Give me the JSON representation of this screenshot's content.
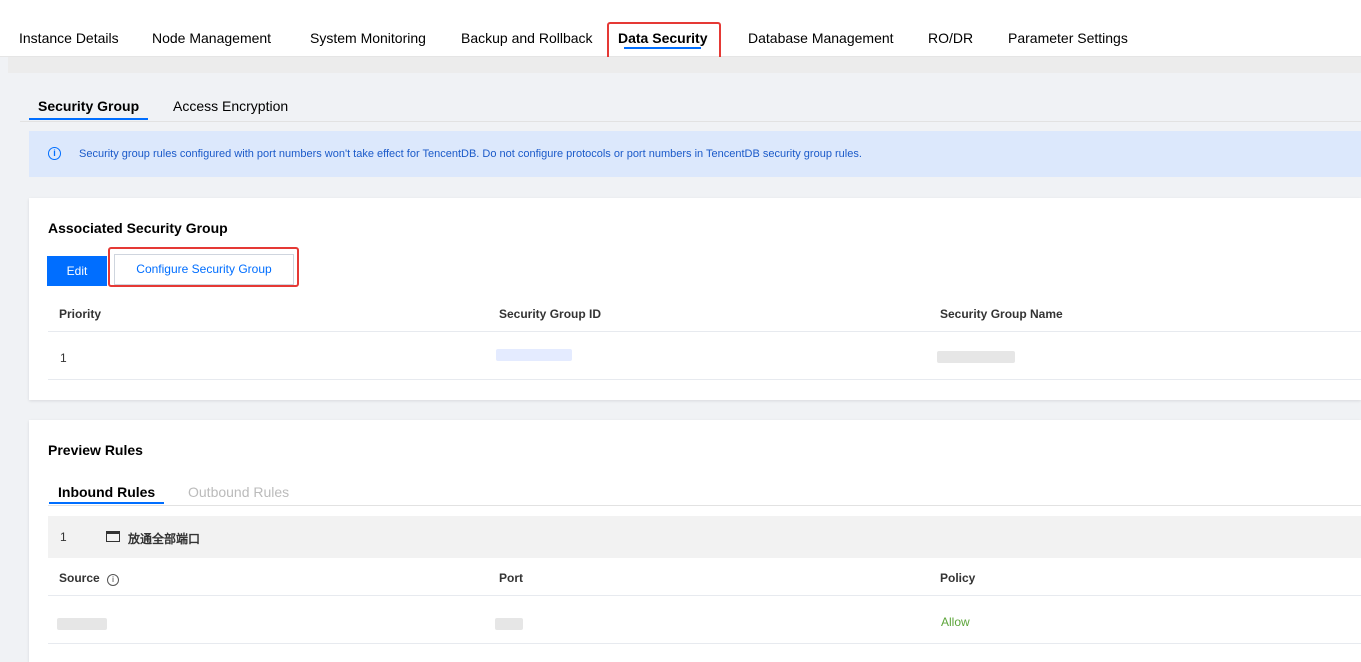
{
  "top_tabs": [
    "Instance Details",
    "Node Management",
    "System Monitoring",
    "Backup and Rollback",
    "Data Security",
    "Database Management",
    "RO/DR",
    "Parameter Settings"
  ],
  "sub_tabs": [
    "Security Group",
    "Access Encryption"
  ],
  "notice_text": "Security group rules configured with port numbers won't take effect for TencentDB. Do not configure protocols or port numbers in TencentDB security group rules.",
  "associated": {
    "title": "Associated Security Group",
    "edit_label": "Edit",
    "configure_label": "Configure Security Group",
    "headers": [
      "Priority",
      "Security Group ID",
      "Security Group Name"
    ],
    "rows": [
      {
        "priority": "1"
      }
    ]
  },
  "preview": {
    "title": "Preview Rules",
    "tabs": [
      "Inbound Rules",
      "Outbound Rules"
    ],
    "group_index": "1",
    "group_name": "放通全部端口",
    "headers": [
      "Source",
      "Port",
      "Policy"
    ],
    "rows": [
      {
        "policy": "Allow"
      }
    ]
  },
  "colors": {
    "accent": "#006eff",
    "highlight": "#e53935",
    "allow": "#5ca53a",
    "notice_bg": "#dce8fc"
  },
  "icons": [
    "info-icon",
    "folder-icon"
  ]
}
